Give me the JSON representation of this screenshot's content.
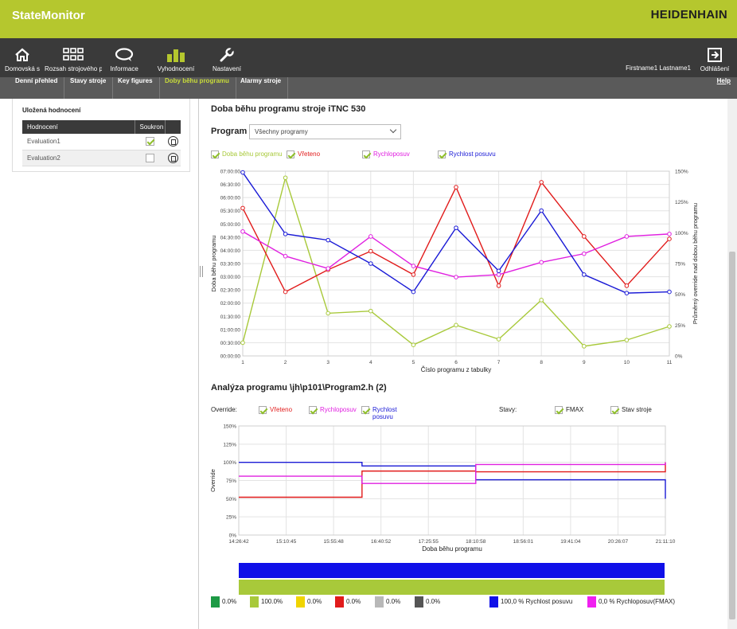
{
  "header": {
    "app_title": "StateMonitor",
    "brand": "HEIDENHAIN",
    "brand_color": "#b5c72e"
  },
  "nav": {
    "items": [
      {
        "label": "Domovská s",
        "icon": "home-icon"
      },
      {
        "label": "Rozsah strojového p",
        "icon": "grid-icon"
      },
      {
        "label": "Informace",
        "icon": "chat-bubble-icon"
      },
      {
        "label": "Vyhodnocení",
        "icon": "bar-chart-icon"
      },
      {
        "label": "Nastavení",
        "icon": "wrench-icon"
      }
    ],
    "user_name": "Firstname1 Lastname1",
    "logout_label": "Odhlášení"
  },
  "subnav": {
    "tabs": [
      "Denní přehled",
      "Stavy stroje",
      "Key figures",
      "Doby běhu programu",
      "Alarmy stroje"
    ],
    "active": "Doby běhu programu",
    "help": "Help"
  },
  "left_panel": {
    "title": "Uložená hodnocení",
    "col_rating": "Hodnocení",
    "col_private": "Soukron",
    "rows": [
      {
        "name": "Evaluation1",
        "private": true
      },
      {
        "name": "Evaluation2",
        "private": false
      }
    ]
  },
  "runtime_section": {
    "title": "Doba běhu programu stroje iTNC 530",
    "program_label": "Program",
    "program_value": "Všechny programy",
    "legend": [
      {
        "label": "Doba běhu programu",
        "color": "#a8c93a"
      },
      {
        "label": "Vřeteno",
        "color": "#e11b1b"
      },
      {
        "label": "Rychloposuv",
        "color": "#e020e0"
      },
      {
        "label": "Rychlost posuvu",
        "color": "#1a1ad6"
      }
    ]
  },
  "analysis_section": {
    "title": "Analýza programu \\jh\\p101\\Program2.h (2)",
    "override_label": "Override:",
    "override_items": [
      {
        "label": "Vřeteno",
        "color": "#e11b1b"
      },
      {
        "label": "Rychloposuv",
        "color": "#e020e0"
      },
      {
        "label": "Rychlost posuvu",
        "color": "#1a1ad6"
      }
    ],
    "states_label": "Stavy:",
    "state_items": [
      {
        "label": "FMAX",
        "color": "#222222"
      },
      {
        "label": "Stav stroje",
        "color": "#222222"
      }
    ],
    "strip_colors": [
      "#1010e8",
      "#a8c93a"
    ],
    "bottom_legend": [
      {
        "label": "0.0%",
        "color": "#1d9a45"
      },
      {
        "label": "100.0%",
        "color": "#a8c93a"
      },
      {
        "label": "0.0%",
        "color": "#f0d400"
      },
      {
        "label": "0.0%",
        "color": "#e11b1b"
      },
      {
        "label": "0.0%",
        "color": "#b8b8b8"
      },
      {
        "label": "0.0%",
        "color": "#555555"
      },
      {
        "label": "100,0 % Rychlost posuvu",
        "color": "#1010e8"
      },
      {
        "label": "0,0 % Rychloposuv(FMAX)",
        "color": "#f020f0"
      }
    ]
  },
  "chart_data": [
    {
      "type": "line",
      "xlabel": "Číslo programu z tabulky",
      "ylabel": "Doba běhu programu",
      "y2label": "Průměrný override nad dobou běhu programu",
      "x": [
        1,
        2,
        3,
        4,
        5,
        6,
        7,
        8,
        9,
        10,
        11
      ],
      "y_ticks": [
        "00:00:00",
        "00:30:00",
        "01:00:00",
        "01:30:00",
        "02:00:00",
        "02:30:00",
        "03:00:00",
        "03:30:00",
        "04:00:00",
        "04:30:00",
        "05:00:00",
        "05:30:00",
        "06:00:00",
        "06:30:00",
        "07:00:00"
      ],
      "y_range_minutes": [
        0,
        420
      ],
      "y2_ticks": [
        "0%",
        "25%",
        "50%",
        "75%",
        "100%",
        "125%",
        "150%"
      ],
      "y2_range": [
        0,
        150
      ],
      "grid": true,
      "series": [
        {
          "name": "Doba běhu programu",
          "axis": "left",
          "unit": "minutes",
          "color": "#a8c93a",
          "values": [
            30,
            405,
            97,
            102,
            25,
            70,
            38,
            127,
            22,
            36,
            67
          ]
        },
        {
          "name": "Vřeteno",
          "axis": "right",
          "unit": "%",
          "color": "#e11b1b",
          "values": [
            120,
            52,
            70,
            85,
            66,
            137,
            57,
            141,
            97,
            57,
            95
          ]
        },
        {
          "name": "Rychloposuv",
          "axis": "right",
          "unit": "%",
          "color": "#e020e0",
          "values": [
            101,
            81,
            71,
            97,
            73,
            64,
            66,
            76,
            83,
            97,
            99
          ]
        },
        {
          "name": "Rychlost posuvu",
          "axis": "right",
          "unit": "%",
          "color": "#1a1ad6",
          "values": [
            149,
            99,
            94,
            75,
            52,
            104,
            69,
            118,
            66,
            51,
            52
          ]
        }
      ]
    },
    {
      "type": "line",
      "subtype": "step",
      "xlabel": "Doba běhu programu",
      "ylabel": "Override",
      "x_ticks": [
        "14:26:42",
        "15:10:45",
        "15:55:48",
        "16:40:52",
        "17:25:55",
        "18:10:58",
        "18:56:01",
        "19:41:04",
        "20:26:07",
        "21:11:10"
      ],
      "y_ticks": [
        "0%",
        "25%",
        "50%",
        "75%",
        "100%",
        "125%",
        "150%"
      ],
      "y_range": [
        0,
        150
      ],
      "grid": true,
      "series": [
        {
          "name": "Rychlost posuvu",
          "color": "#1a1ad6",
          "segments": [
            {
              "from": 0,
              "to": 2.6,
              "value": 100
            },
            {
              "from": 2.6,
              "to": 5.0,
              "value": 95
            },
            {
              "from": 5.0,
              "to": 9.0,
              "value": 76
            }
          ]
        },
        {
          "name": "Vřeteno",
          "color": "#e11b1b",
          "segments": [
            {
              "from": 0,
              "to": 2.6,
              "value": 52
            },
            {
              "from": 2.6,
              "to": 5.0,
              "value": 88
            },
            {
              "from": 5.0,
              "to": 9.0,
              "value": 87
            }
          ]
        },
        {
          "name": "Rychloposuv",
          "color": "#e020e0",
          "segments": [
            {
              "from": 0,
              "to": 2.6,
              "value": 81
            },
            {
              "from": 2.6,
              "to": 5.0,
              "value": 71
            },
            {
              "from": 5.0,
              "to": 9.0,
              "value": 97
            }
          ]
        }
      ]
    }
  ]
}
